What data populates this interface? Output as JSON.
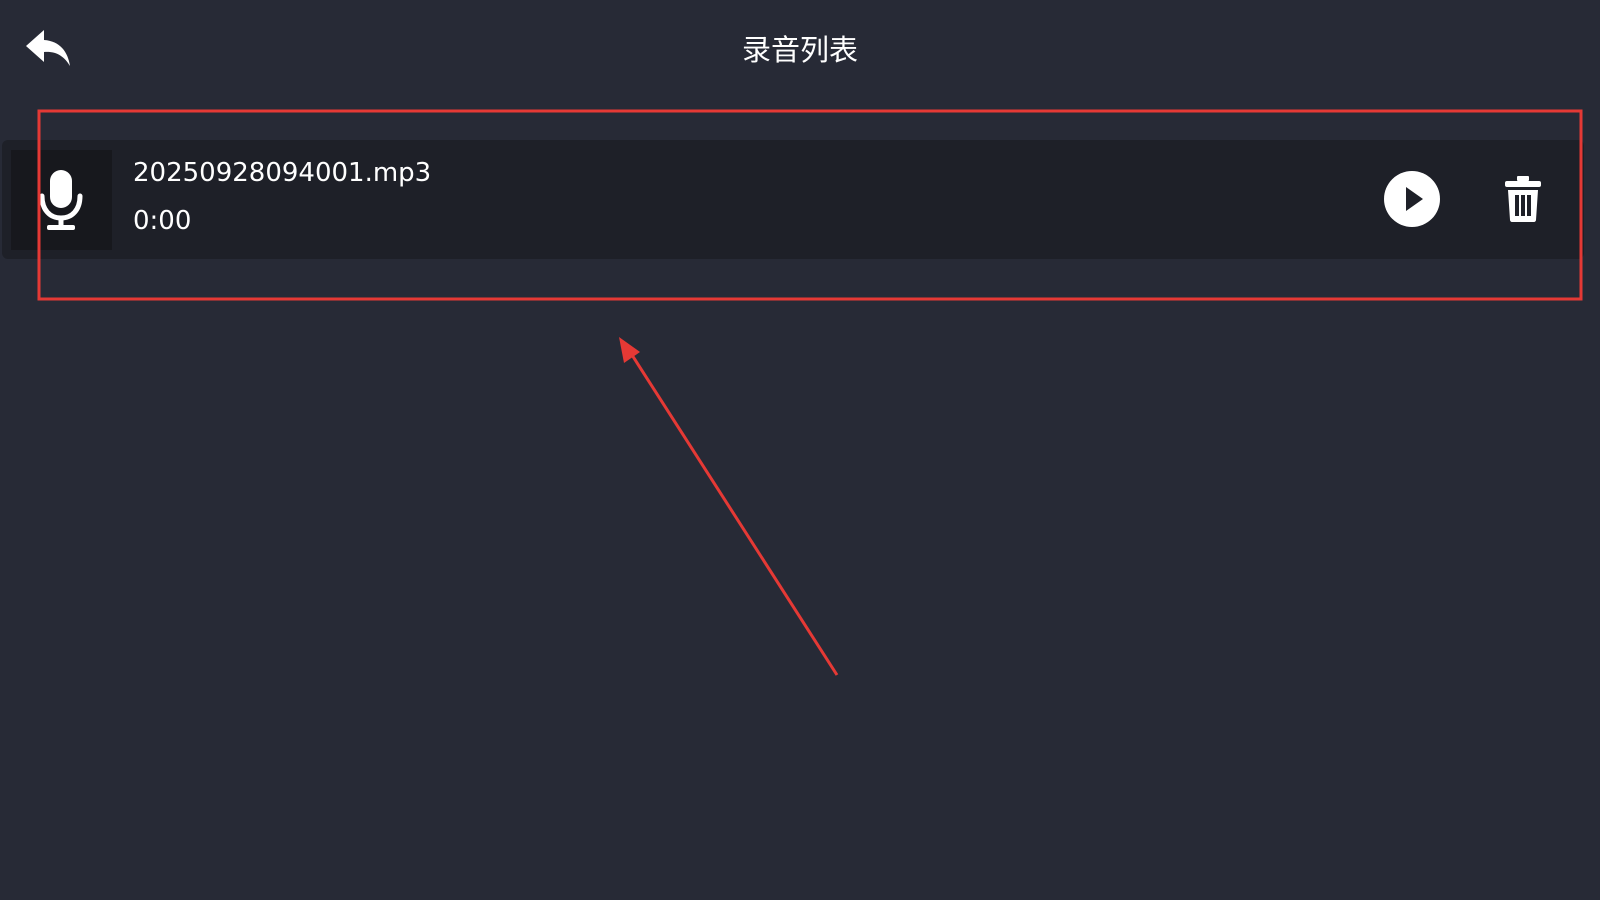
{
  "header": {
    "title": "录音列表",
    "back_icon": "back-arrow-icon"
  },
  "recordings": [
    {
      "file_name": "20250928094001.mp3",
      "duration": "0:00",
      "icon": "microphone-icon",
      "actions": [
        "play-icon",
        "trash-icon"
      ]
    }
  ],
  "colors": {
    "background": "#272a36",
    "row_background": "#1e2028",
    "icon_box_background": "#17181d",
    "text": "#ffffff",
    "annotation": "#e53935"
  }
}
